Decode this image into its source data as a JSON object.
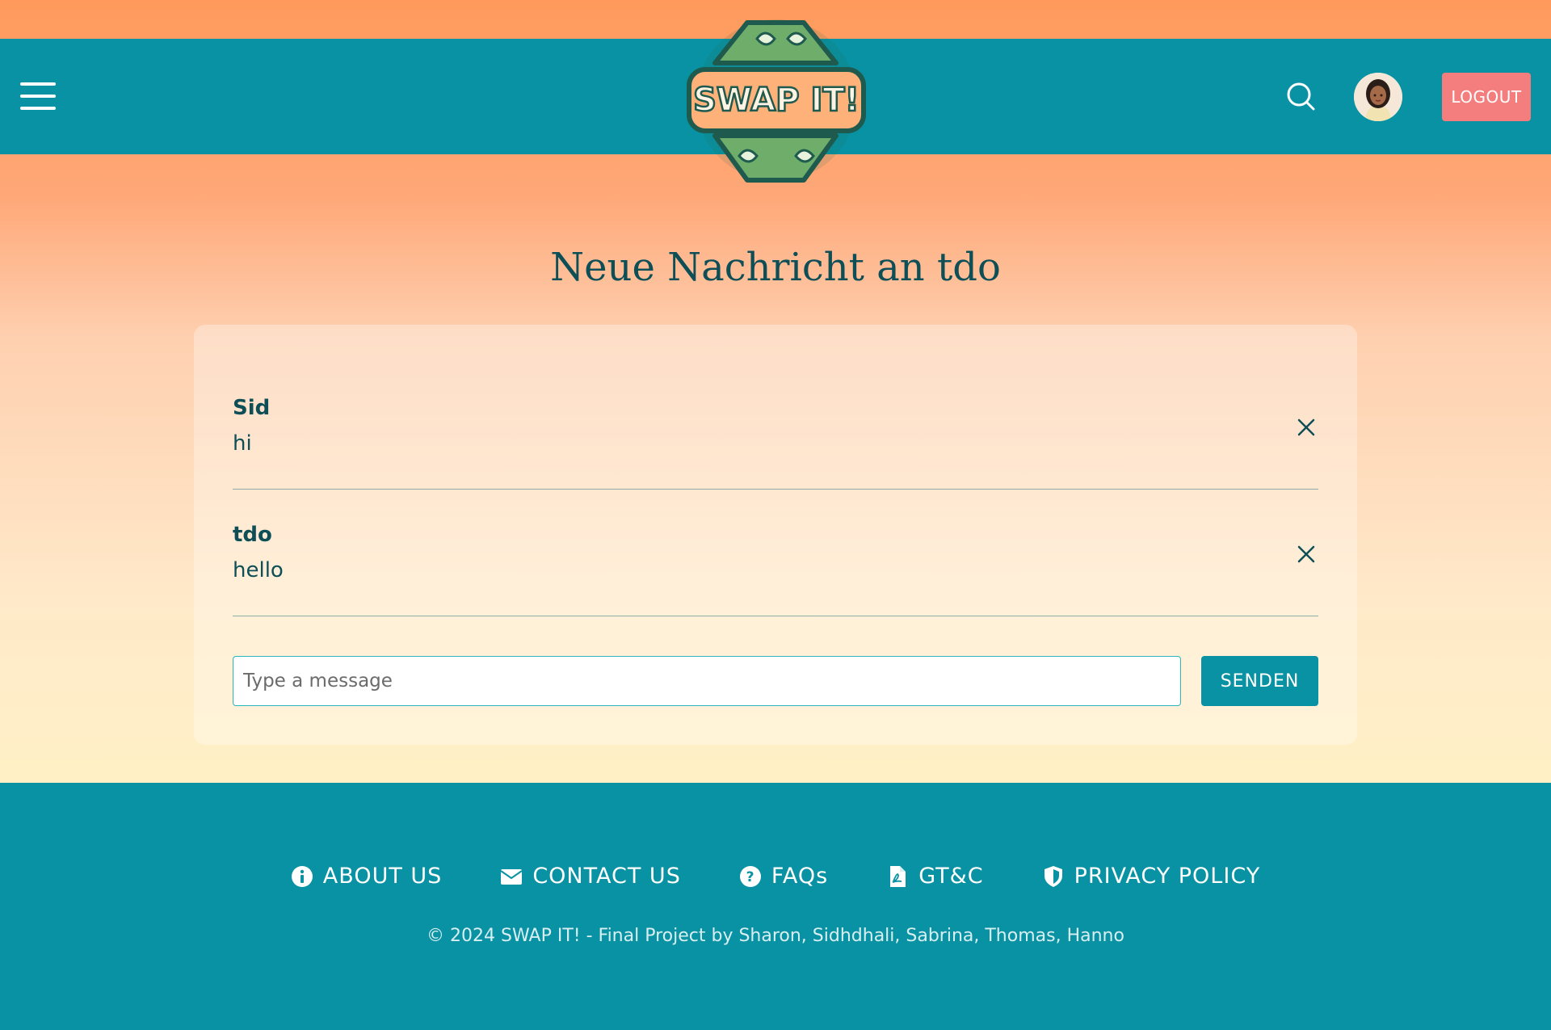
{
  "header": {
    "logo_text": "SWAP IT!",
    "logout_label": "LOGOUT"
  },
  "page": {
    "title": "Neue Nachricht an tdo"
  },
  "messages": [
    {
      "author": "Sid",
      "text": "hi"
    },
    {
      "author": "tdo",
      "text": "hello"
    }
  ],
  "composer": {
    "placeholder": "Type a message",
    "value": "",
    "send_label": "SENDEN"
  },
  "footer": {
    "links": [
      {
        "label": "ABOUT US",
        "icon": "info-icon"
      },
      {
        "label": "CONTACT US",
        "icon": "envelope-icon"
      },
      {
        "label": "FAQs",
        "icon": "question-icon"
      },
      {
        "label": "GT&C",
        "icon": "pdf-file-icon"
      },
      {
        "label": "PRIVACY POLICY",
        "icon": "shield-icon"
      }
    ],
    "copyright": "© 2024 SWAP IT! - Final Project by Sharon, Sidhdhali, Sabrina, Thomas, Hanno"
  },
  "colors": {
    "header_bg": "#0892a3",
    "accent_orange": "#ff9a5c",
    "logout_bg": "#f47e7e",
    "text_dark": "#0e4f57"
  }
}
